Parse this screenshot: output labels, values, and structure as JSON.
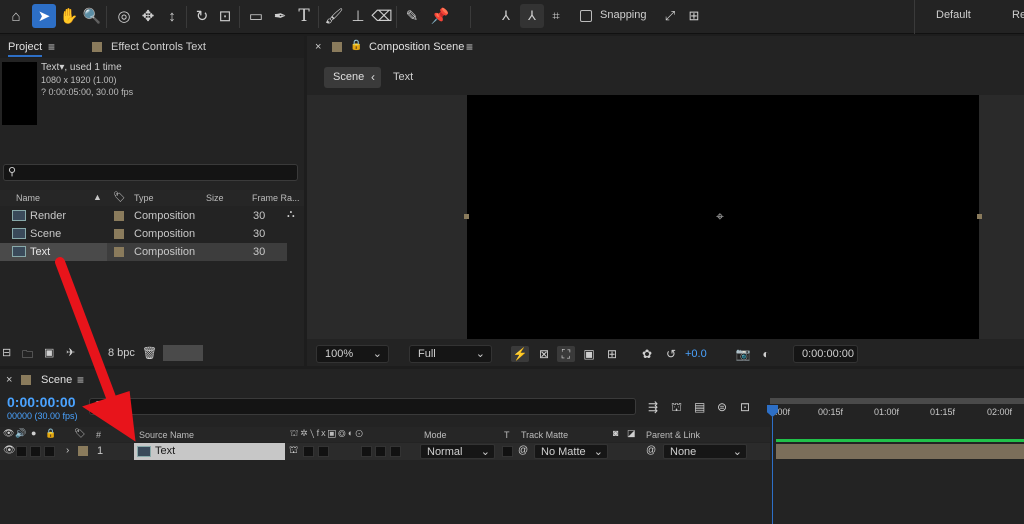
{
  "toolbar": {
    "snapping_label": "Snapping",
    "workspace_default": "Default",
    "workspace_next": "Re"
  },
  "project_panel": {
    "tab_label": "Project",
    "effect_controls_label": "Effect Controls Text",
    "item_name": "Text",
    "item_used": ", used 1 time",
    "item_dims": "1080 x 1920 (1.00)",
    "item_duration": "? 0:00:05:00, 30.00 fps",
    "columns": {
      "name": "Name",
      "type": "Type",
      "size": "Size",
      "frame_rate": "Frame Ra..."
    },
    "items": [
      {
        "name": "Render",
        "type": "Composition",
        "fps": "30"
      },
      {
        "name": "Scene",
        "type": "Composition",
        "fps": "30"
      },
      {
        "name": "Text",
        "type": "Composition",
        "fps": "30"
      }
    ],
    "bpc_label": "8 bpc"
  },
  "composition_panel": {
    "tab_label": "Composition Scene",
    "breadcrumb_scene": "Scene",
    "breadcrumb_text": "Text",
    "zoom": "100%",
    "resolution": "Full",
    "exposure": "+0.0",
    "timecode": "0:00:00:00"
  },
  "timeline": {
    "tab_label": "Scene",
    "current_time": "0:00:00:00",
    "frame_info": "00000 (30.00 fps)",
    "columns": {
      "num": "#",
      "source_name": "Source Name",
      "mode": "Mode",
      "t": "T",
      "track_matte": "Track Matte",
      "parent": "Parent & Link"
    },
    "ruler_ticks": [
      "0:00f",
      "00:15f",
      "01:00f",
      "01:15f",
      "02:00f"
    ],
    "layers": [
      {
        "num": "1",
        "name": "Text",
        "mode": "Normal",
        "matte": "No Matte",
        "parent": "None"
      }
    ]
  },
  "colors": {
    "accent": "#2d6fc6",
    "timecode": "#4aa3ff",
    "annotation_arrow": "#e8141b",
    "label_swatch": "#8a7b5c"
  }
}
